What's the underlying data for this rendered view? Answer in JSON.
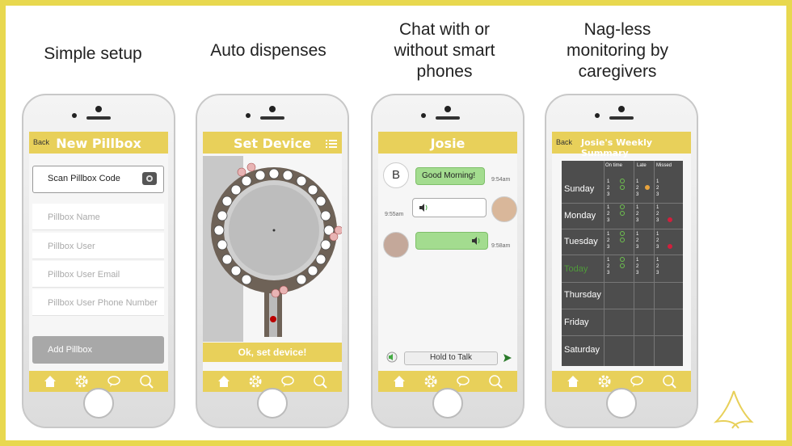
{
  "captions": {
    "setup": "Simple setup",
    "dispense": "Auto dispenses",
    "chat_line1": "Chat with or",
    "chat_line2": "without smart",
    "chat_line3": "phones",
    "monitor_line1": "Nag-less",
    "monitor_line2": "monitoring by",
    "monitor_line3": "caregivers"
  },
  "colors": {
    "accent": "#e8d05a",
    "frame": "#e8d84f",
    "chat_bubble": "#a3dc8f",
    "dark_grid": "#4d4d4d"
  },
  "phone1": {
    "back": "Back",
    "title": "New Pillbox",
    "scan_label": "Scan Pillbox Code",
    "fields": [
      "Pillbox Name",
      "Pillbox User",
      "Pillbox User Email",
      "Pillbox User Phone Number"
    ],
    "add_button": "Add Pillbox"
  },
  "phone2": {
    "title": "Set Device",
    "confirm_button": "Ok, set device!"
  },
  "phone3": {
    "title": "Josie",
    "msg1": "Good Morning!",
    "msg1_time": "9:54am",
    "msg1_avatar": "B",
    "msg2_time": "9:55am",
    "msg3_time": "9:58am",
    "talk_button": "Hold to Talk"
  },
  "phone4": {
    "back": "Back",
    "title": "Josie's Weekly Summary",
    "columns": [
      "On time",
      "Late",
      "Missed"
    ],
    "days": [
      "Sunday",
      "Monday",
      "Tuesday",
      "Today",
      "Thursday",
      "Friday",
      "Saturday"
    ],
    "slots": [
      "1",
      "2",
      "3"
    ]
  },
  "icons": [
    "home-icon",
    "gear-icon",
    "chat-icon",
    "search-pill-icon",
    "camera-icon",
    "menu-icon",
    "speaker-icon",
    "send-icon"
  ]
}
